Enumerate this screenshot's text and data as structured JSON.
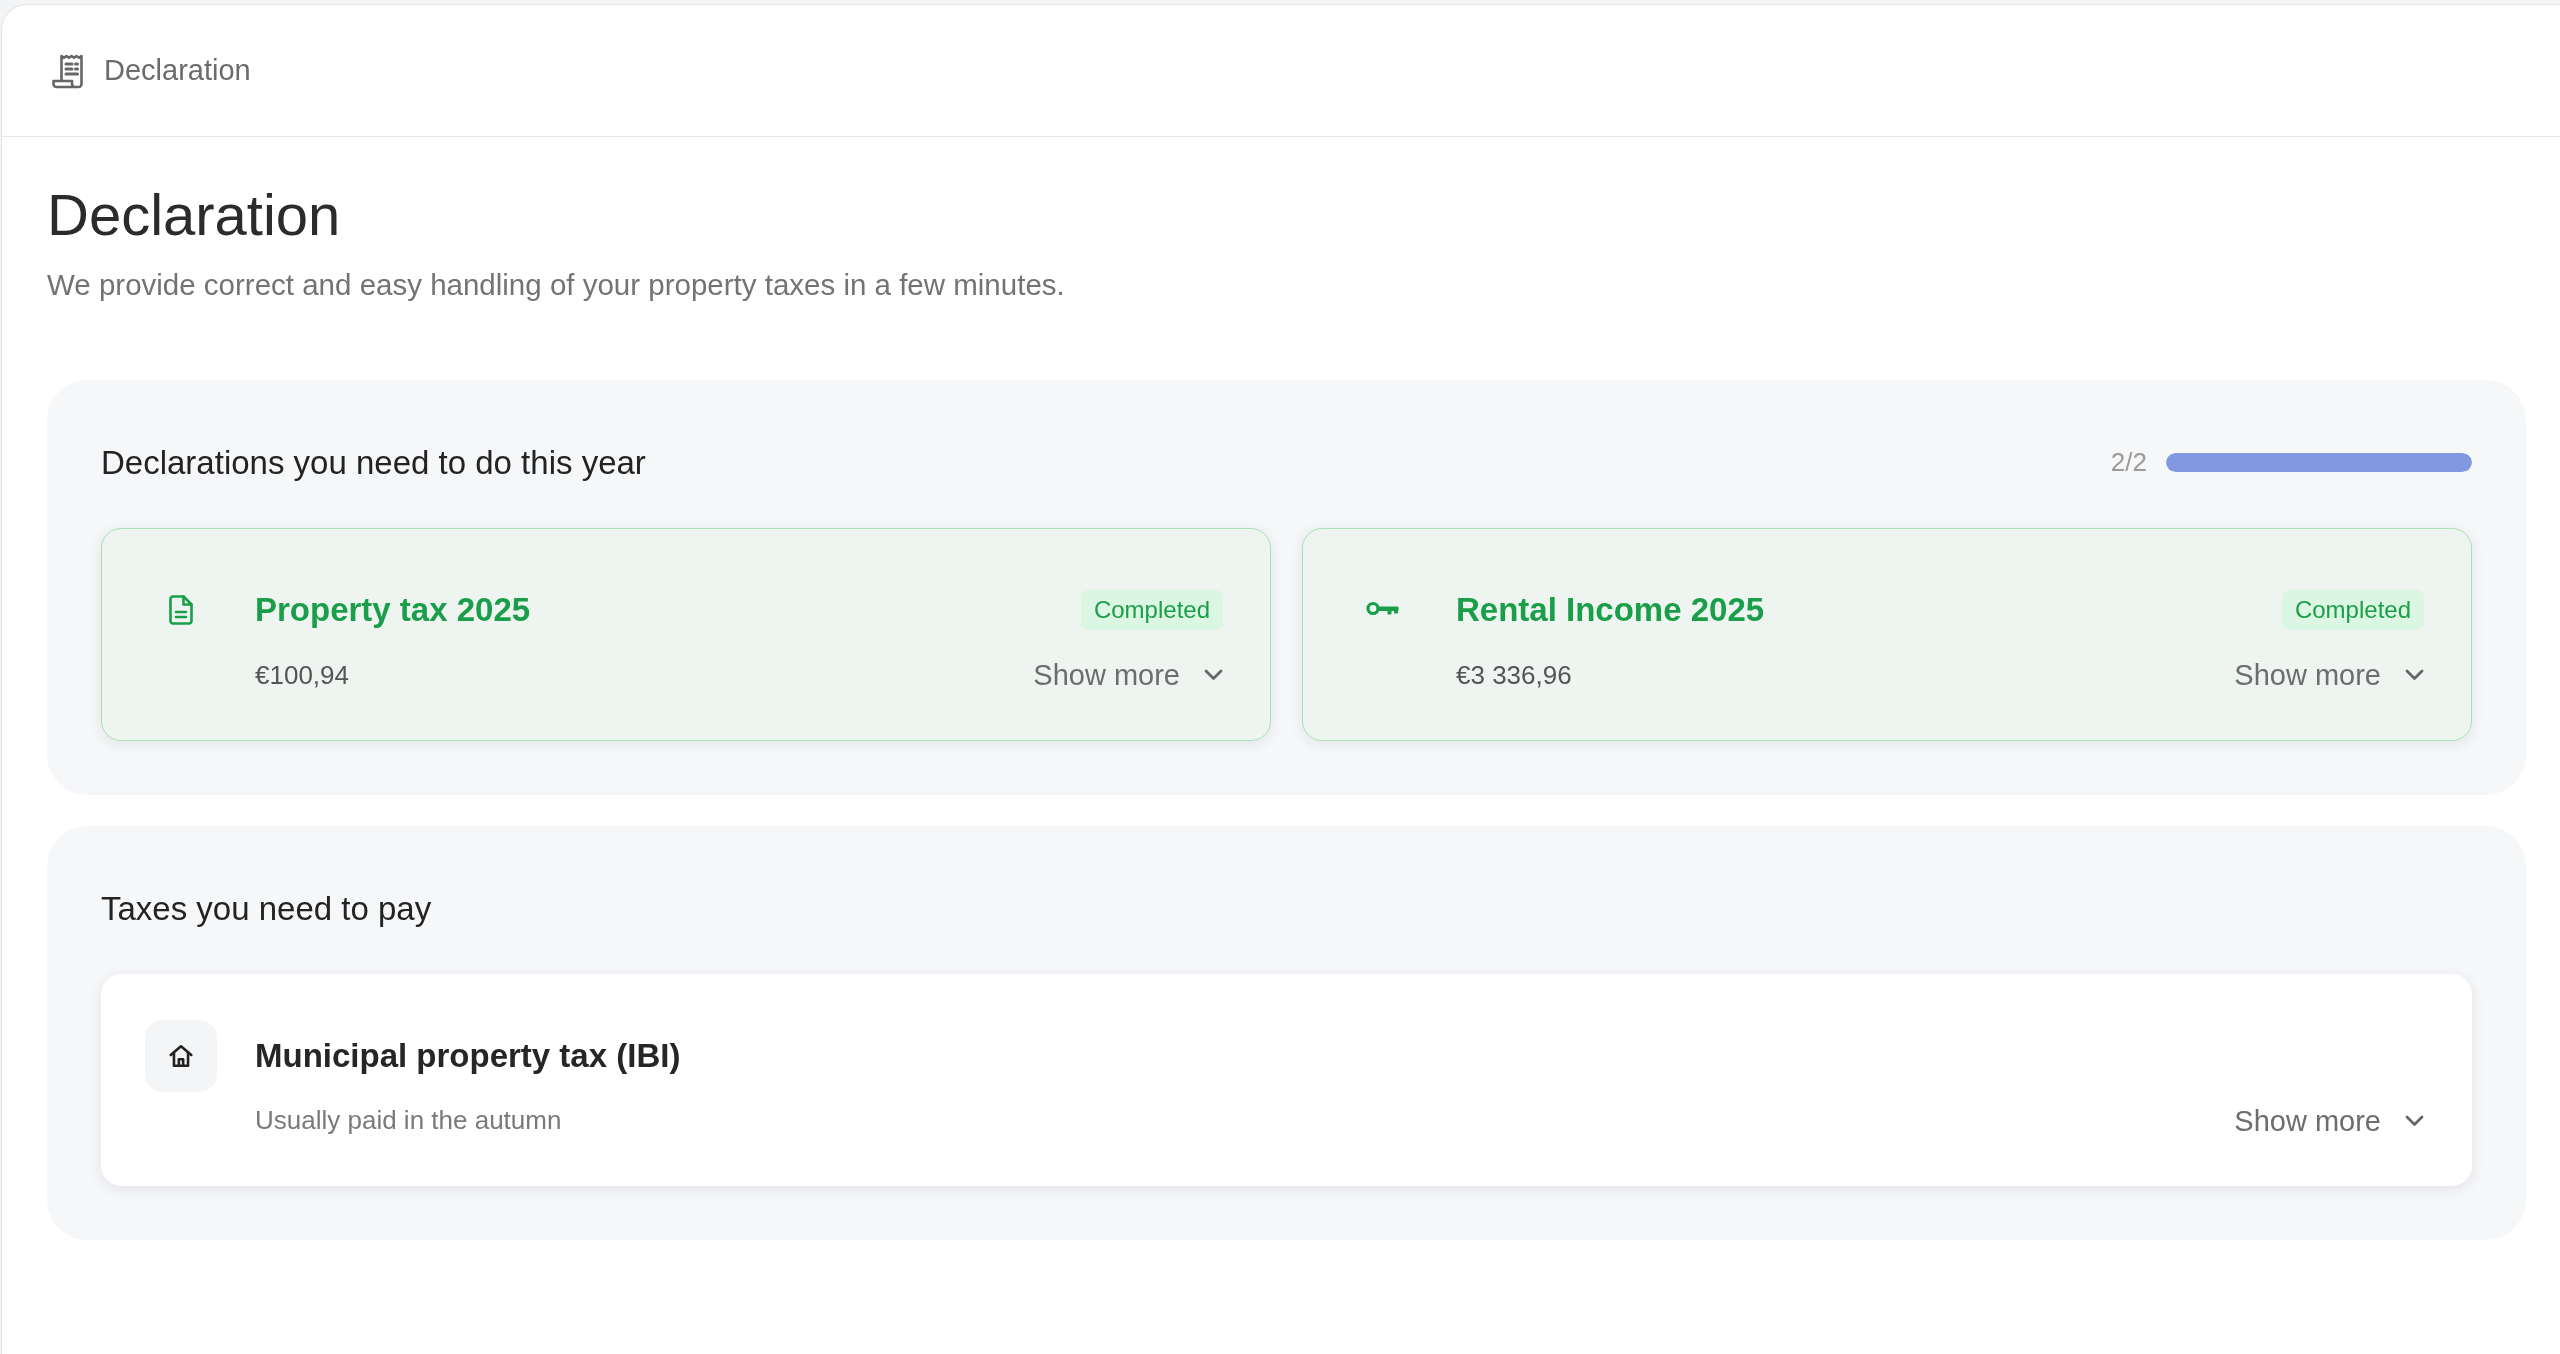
{
  "header": {
    "title": "Declaration"
  },
  "page": {
    "title": "Declaration",
    "subtitle": "We provide correct and easy handling of your property taxes in a few minutes."
  },
  "sections": [
    {
      "title": "Declarations you need to do this year",
      "progress": {
        "reading": "2/2",
        "level": 1
      },
      "items": [
        {
          "title": "Property tax 2025",
          "detail": "€100,94",
          "badge": "Completed",
          "completed": true,
          "action": "Show more",
          "expanded": false
        },
        {
          "title": "Rental Income 2025",
          "detail": "€3 336,96",
          "badge": "Completed",
          "completed": true,
          "action": "Show more",
          "expanded": false
        }
      ]
    },
    {
      "title": "Taxes you need to pay",
      "items": [
        {
          "title": "Municipal property tax (IBI)",
          "detail": "Usually paid in the autumn",
          "completed": false,
          "action": "Show more",
          "expanded": false
        }
      ]
    }
  ]
}
